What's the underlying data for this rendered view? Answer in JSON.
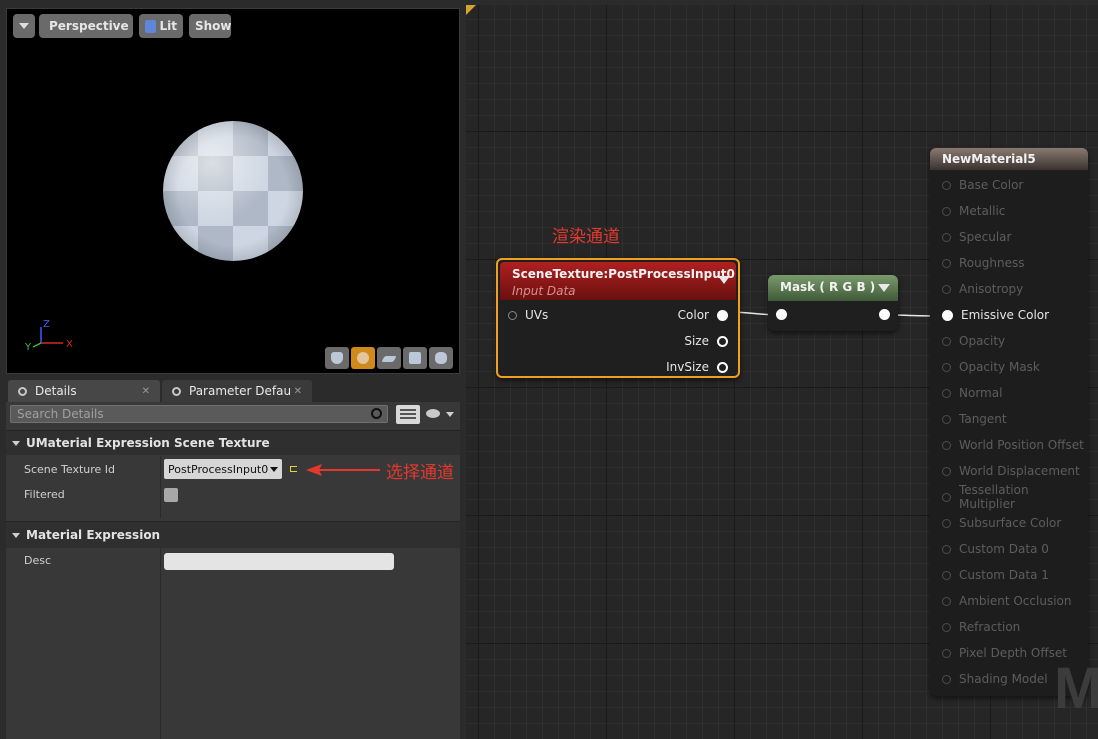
{
  "viewport": {
    "buttons": {
      "perspective": "Perspective",
      "lit": "Lit",
      "show": "Show"
    },
    "axis": {
      "x": "X",
      "y": "Y",
      "z": "Z"
    }
  },
  "details": {
    "tabs": [
      {
        "label": "Details"
      },
      {
        "label": "Parameter Defaults"
      }
    ],
    "search_placeholder": "Search Details",
    "sections": [
      {
        "title": "UMaterial Expression Scene Texture"
      },
      {
        "title": "Material Expression"
      }
    ],
    "properties": {
      "scene_texture_id": {
        "label": "Scene Texture Id",
        "value": "PostProcessInput0"
      },
      "filtered": {
        "label": "Filtered",
        "checked": false
      },
      "desc": {
        "label": "Desc",
        "value": ""
      }
    },
    "annotation": "选择通道"
  },
  "graph": {
    "annotation": "渲染通道",
    "scene_texture_node": {
      "title": "SceneTexture:PostProcessInput0",
      "subtitle": "Input Data",
      "inputs": [
        "UVs"
      ],
      "outputs": [
        "Color",
        "Size",
        "InvSize"
      ]
    },
    "mask_node": {
      "title": "Mask ( R G B )"
    },
    "material_node": {
      "title": "NewMaterial5",
      "pins": [
        "Base Color",
        "Metallic",
        "Specular",
        "Roughness",
        "Anisotropy",
        "Emissive Color",
        "Opacity",
        "Opacity Mask",
        "Normal",
        "Tangent",
        "World Position Offset",
        "World Displacement",
        "Tessellation Multiplier",
        "Subsurface Color",
        "Custom Data 0",
        "Custom Data 1",
        "Ambient Occlusion",
        "Refraction",
        "Pixel Depth Offset",
        "Shading Model"
      ],
      "active_pin": "Emissive Color"
    },
    "watermark": "M"
  },
  "colors": {
    "scene_node_header": "#a51c1c",
    "selection_border": "#f0a020",
    "mask_node_header": "#5f7f55",
    "annotation": "#e4382e"
  }
}
